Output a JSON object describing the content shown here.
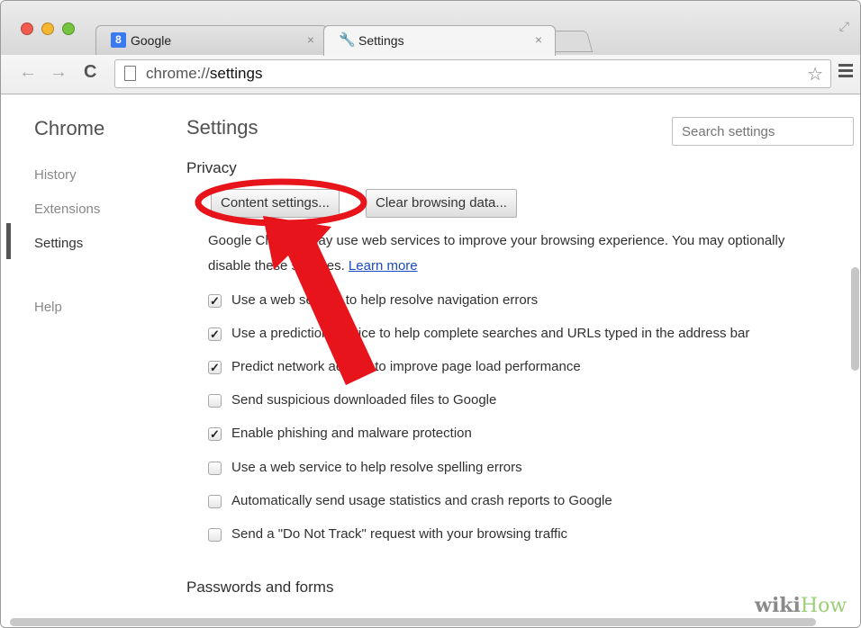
{
  "tabs": [
    {
      "title": "Google",
      "favicon": "google-favicon",
      "favicon_text": "8",
      "close": "×"
    },
    {
      "title": "Settings",
      "favicon": "wrench-icon",
      "close": "×"
    }
  ],
  "toolbar": {
    "url_prefix": "chrome://",
    "url_path": "settings",
    "back_icon": "←",
    "forward_icon": "→",
    "reload_icon": "C",
    "star_icon": "☆"
  },
  "sidebar": {
    "title": "Chrome",
    "items": [
      {
        "label": "History"
      },
      {
        "label": "Extensions"
      },
      {
        "label": "Settings"
      },
      {
        "label": "Help"
      }
    ]
  },
  "main": {
    "title": "Settings",
    "search_placeholder": "Search settings",
    "privacy": {
      "heading": "Privacy",
      "content_settings_button": "Content settings...",
      "clear_data_button": "Clear browsing data...",
      "description": "Google Chrome may use web services to improve your browsing experience. You may optionally disable these services.",
      "learn_more": "Learn more",
      "options": [
        {
          "label": "Use a web service to help resolve navigation errors",
          "checked": true
        },
        {
          "label": "Use a prediction service to help complete searches and URLs typed in the address bar",
          "checked": true
        },
        {
          "label": "Predict network actions to improve page load performance",
          "checked": true
        },
        {
          "label": "Send suspicious downloaded files to Google",
          "checked": false
        },
        {
          "label": "Enable phishing and malware protection",
          "checked": true
        },
        {
          "label": "Use a web service to help resolve spelling errors",
          "checked": false
        },
        {
          "label": "Automatically send usage statistics and crash reports to Google",
          "checked": false
        },
        {
          "label": "Send a \"Do Not Track\" request with your browsing traffic",
          "checked": false
        }
      ]
    },
    "passwords_heading": "Passwords and forms"
  },
  "watermark": {
    "wiki": "wiki",
    "how": "How"
  },
  "colors": {
    "annotation": "#e8141c",
    "link": "#1a4bc4"
  }
}
